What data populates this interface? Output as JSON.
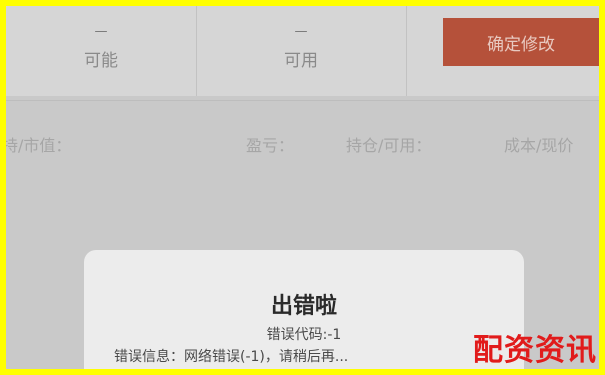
{
  "toolbar": {
    "col1": {
      "dash": "—",
      "label": "可能"
    },
    "col2": {
      "dash": "—",
      "label": "可用"
    },
    "confirm_label": "确定修改"
  },
  "fields": [
    {
      "label": "持/市值："
    },
    {
      "label": "盈亏："
    },
    {
      "label": "持仓/可用："
    },
    {
      "label": "成本/现价"
    }
  ],
  "dialog": {
    "title": "出错啦",
    "code": "错误代码:-1",
    "info": "错误信息：网络错误(-1)，请稍后再..."
  },
  "watermark": "配资资讯",
  "colors": {
    "border": "#ffff00",
    "button": "#b5513a",
    "watermark": "#e11b1b"
  }
}
